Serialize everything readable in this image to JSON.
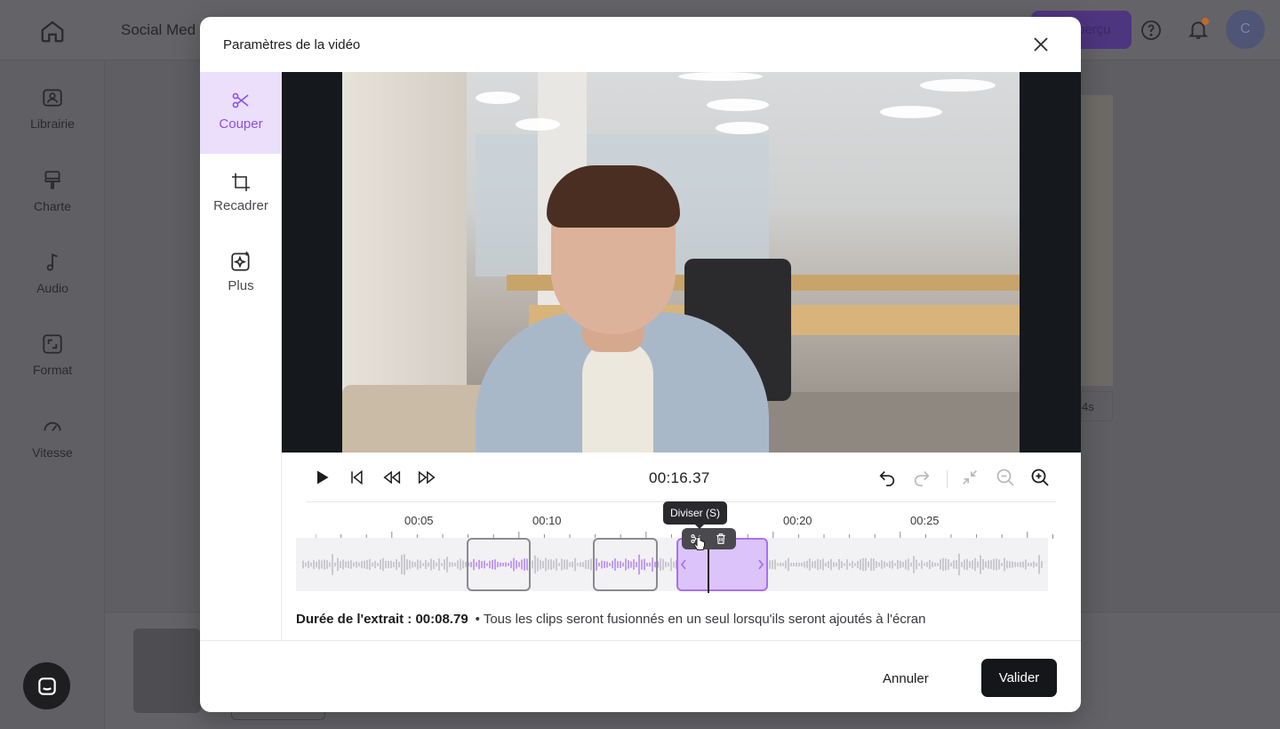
{
  "background": {
    "app_title": "Social Med",
    "preview_label": "perçu",
    "avatar_initial": "C",
    "nav": [
      {
        "label": "Librairie",
        "icon": "library-icon"
      },
      {
        "label": "Charte",
        "icon": "brush-icon"
      },
      {
        "label": "Audio",
        "icon": "music-note-icon"
      },
      {
        "label": "Format",
        "icon": "format-icon"
      },
      {
        "label": "Vitesse",
        "icon": "speedometer-icon"
      }
    ],
    "side_card_label": "4s"
  },
  "modal": {
    "title": "Paramètres de la vidéo",
    "tools": [
      {
        "label": "Couper",
        "icon": "scissors-icon",
        "active": true
      },
      {
        "label": "Recadrer",
        "icon": "crop-icon",
        "active": false
      },
      {
        "label": "Plus",
        "icon": "sparkle-icon",
        "active": false
      }
    ],
    "player": {
      "timecode": "00:16.37"
    },
    "timeline": {
      "tick_labels": [
        "00:05",
        "00:10",
        "00:20",
        "00:25"
      ],
      "tooltip": "Diviser (S)"
    },
    "summary": {
      "duration_label": "Durée de l'extrait : 00:08.79",
      "note": "• Tous les clips seront fusionnés en un seul lorsqu'ils seront ajoutés à l'écran"
    },
    "footer": {
      "cancel_label": "Annuler",
      "validate_label": "Valider"
    }
  },
  "colors": {
    "accent": "#a970f3",
    "accent_light": "#ecdffb",
    "primary_button": "#15161a"
  }
}
